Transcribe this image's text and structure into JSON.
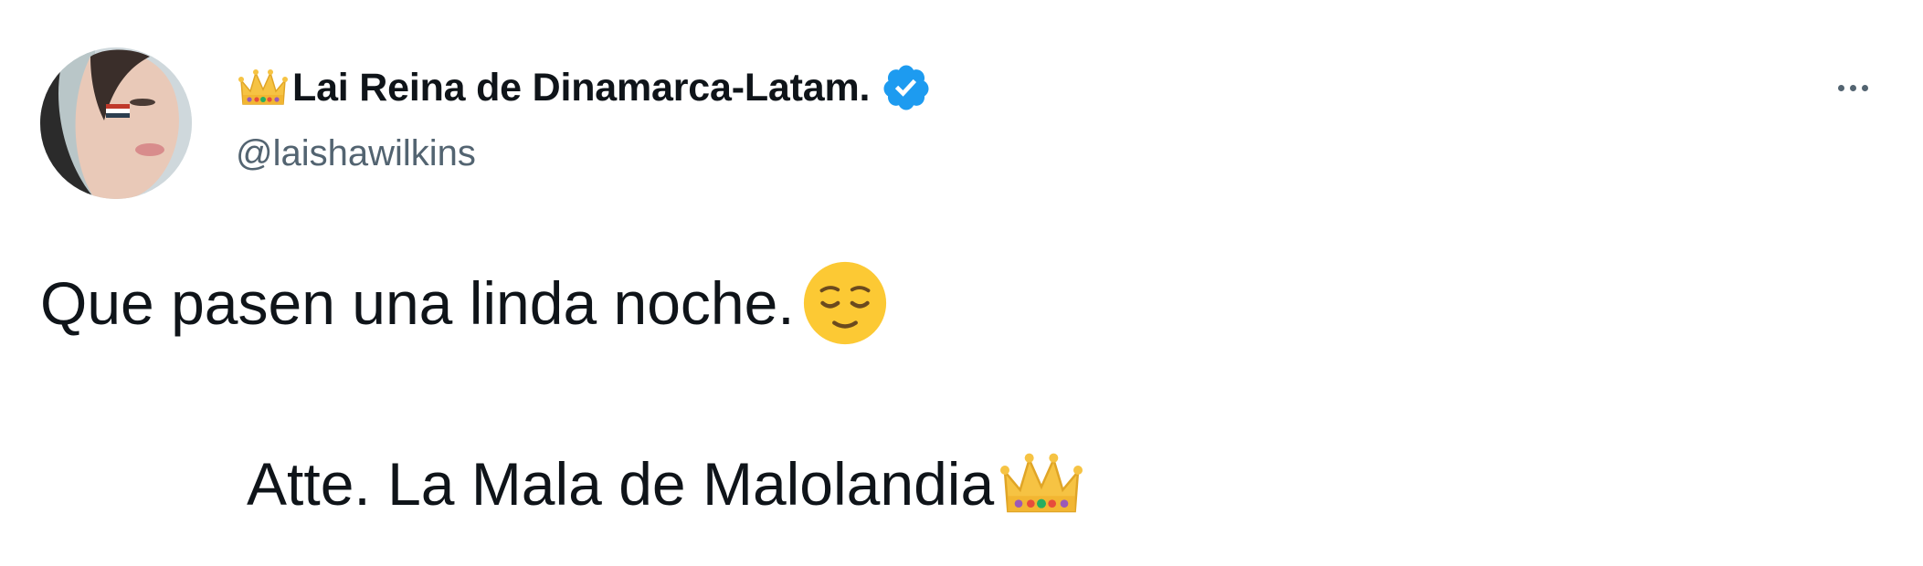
{
  "tweet": {
    "author": {
      "display_name": "Lai Reina de Dinamarca-Latam.",
      "handle": "@laishawilkins",
      "verified": true,
      "name_prefix_icon": "crown-emoji",
      "avatar_icon": "profile-photo"
    },
    "more_icon": "more-options-icon",
    "body": {
      "line1": "Que pasen una linda noche.",
      "line1_emoji": "relieved-face-emoji",
      "line2": "Atte. La Mala de Malolandia",
      "line2_emoji": "crown-emoji"
    }
  },
  "colors": {
    "text_primary": "#0f1419",
    "text_secondary": "#536471",
    "verified_blue": "#1d9bf0",
    "background": "#ffffff"
  }
}
